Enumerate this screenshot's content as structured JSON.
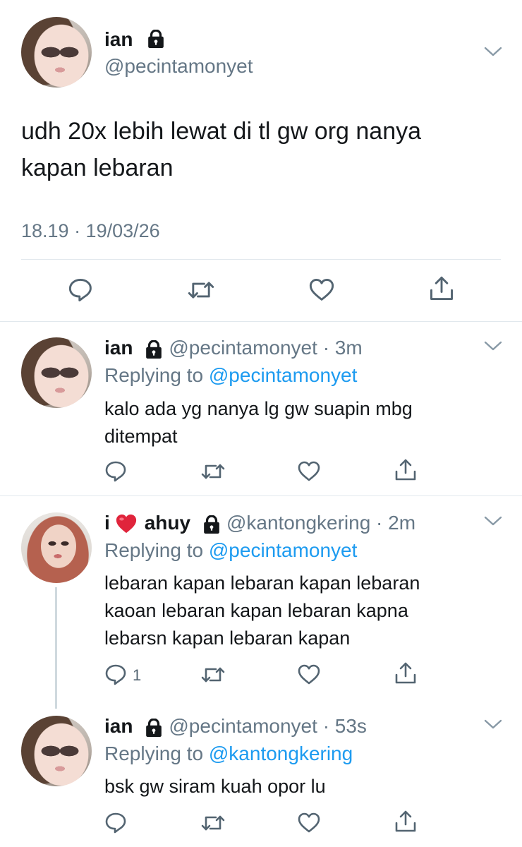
{
  "main_tweet": {
    "name": "ian",
    "handle": "@pecintamonyet",
    "text_line1": "udh 20x lebih lewat di tl gw org nanya",
    "text_line2": "kapan lebaran",
    "timestamp": "18.19 · 19/03/26"
  },
  "replies": [
    {
      "name": "ian",
      "handle": "@pecintamonyet · 3m",
      "replying_prefix": "Replying to",
      "replying_to": "@pecintamonyet",
      "text": "kalo ada yg nanya lg gw suapin mbg ditempat",
      "reply_count": ""
    },
    {
      "name_prefix": "i",
      "name_suffix": "ahuy",
      "handle": "@kantongkering · 2m",
      "replying_prefix": "Replying to",
      "replying_to": "@pecintamonyet",
      "text": "lebaran kapan lebaran kapan lebaran kaoan lebaran kapan lebaran kapna lebarsn kapan lebaran kapan",
      "reply_count": "1"
    },
    {
      "name": "ian",
      "handle": "@pecintamonyet · 53s",
      "replying_prefix": "Replying to",
      "replying_to": "@kantongkering",
      "text": "bsk gw siram kuah opor lu",
      "reply_count": ""
    }
  ],
  "colors": {
    "text": "#14171a",
    "secondary": "#657786",
    "link": "#1d9bf0",
    "icon": "#536471",
    "divider": "#e1e8ed",
    "heart_emoji": "#e0243b"
  },
  "icons": [
    "lock-icon",
    "chevron-down-icon",
    "reply-icon",
    "retweet-icon",
    "like-icon",
    "share-icon",
    "red-heart-emoji"
  ]
}
